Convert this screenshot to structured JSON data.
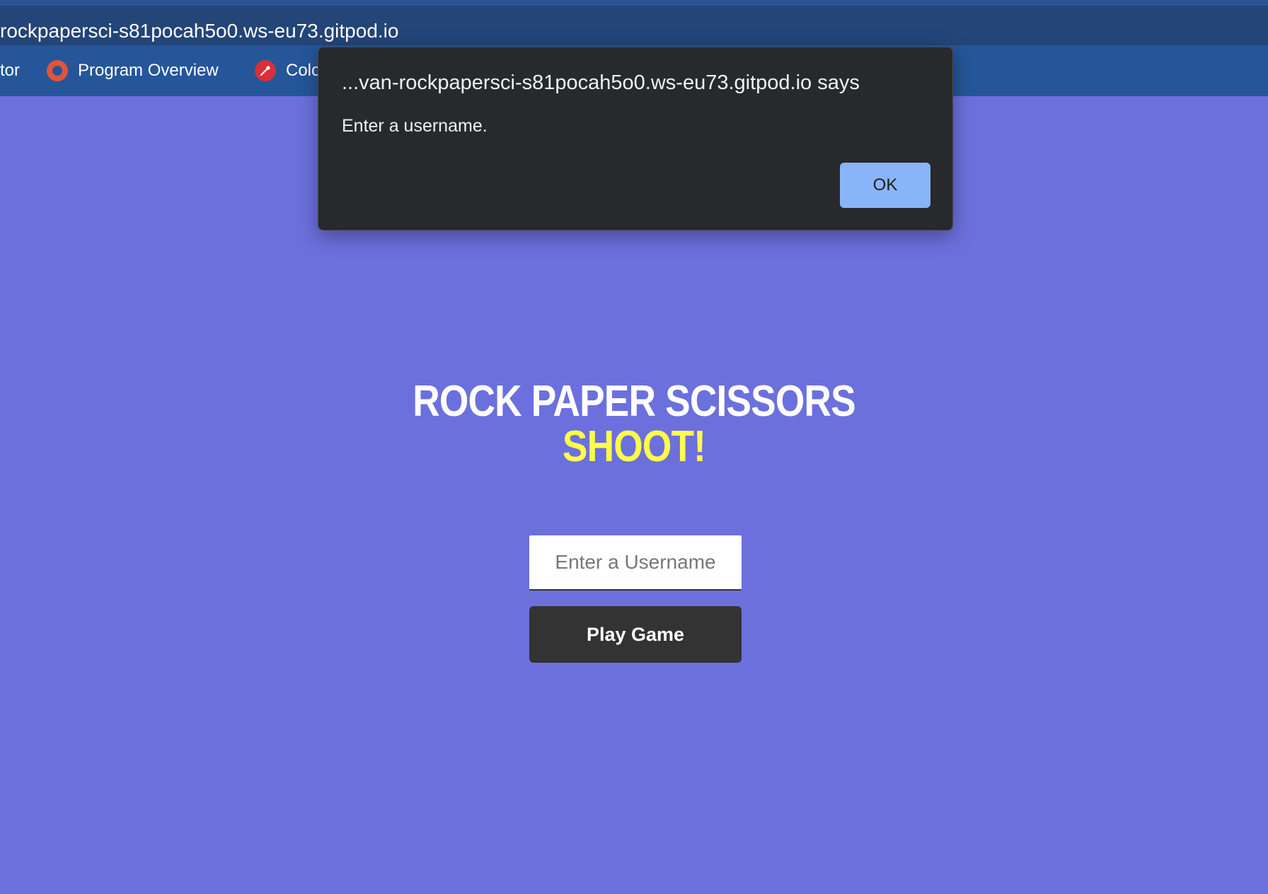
{
  "browser": {
    "url": "rockpapersci-s81pocah5o0.ws-eu73.gitpod.io",
    "bookmarks": [
      {
        "label": "tor",
        "icon": "none"
      },
      {
        "label": "Program Overview",
        "icon": "ring-icon"
      },
      {
        "label": "Colo",
        "icon": "color-picker-icon"
      }
    ]
  },
  "dialog": {
    "title": "...van-rockpapersci-s81pocah5o0.ws-eu73.gitpod.io says",
    "message": "Enter a username.",
    "ok_label": "OK"
  },
  "game": {
    "title_line1": "ROCK PAPER SCISSORS",
    "title_line2": "SHOOT!",
    "username_placeholder": "Enter a Username",
    "play_label": "Play Game"
  },
  "colors": {
    "background": "#6c70dd",
    "accent_yellow": "#fdfd4a",
    "button_dark": "#333333",
    "dialog_ok": "#8ab4f8"
  }
}
